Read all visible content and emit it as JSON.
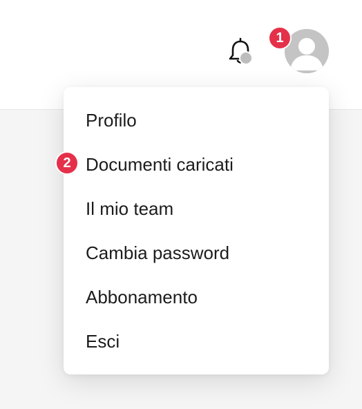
{
  "header": {
    "notifications_icon": "bell-icon",
    "avatar_icon": "user-avatar-icon"
  },
  "annotations": {
    "badge_1": "1",
    "badge_2": "2",
    "badge_color": "#e5304a"
  },
  "menu": {
    "items": [
      {
        "label": "Profilo"
      },
      {
        "label": "Documenti caricati"
      },
      {
        "label": "Il mio team"
      },
      {
        "label": "Cambia password"
      },
      {
        "label": "Abbonamento"
      },
      {
        "label": "Esci"
      }
    ]
  }
}
